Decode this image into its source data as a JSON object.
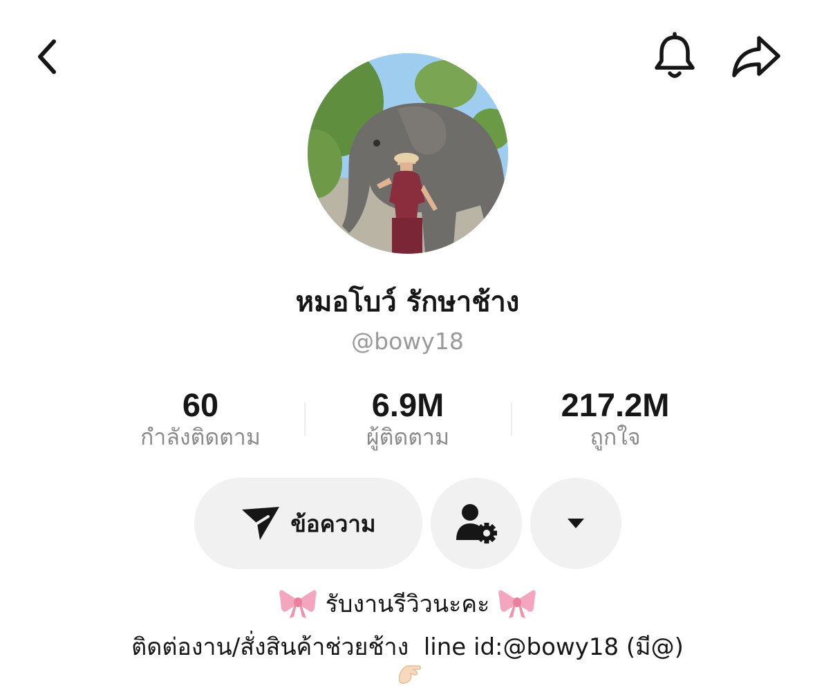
{
  "nav": {
    "back_icon": "chevron-left-icon",
    "bell_icon": "bell-icon",
    "share_icon": "share-icon"
  },
  "profile": {
    "display_name": "หมอโบว์ รักษาช้าง",
    "username": "@bowy18"
  },
  "stats": {
    "following": {
      "value": "60",
      "label": "กำลังติดตาม"
    },
    "followers": {
      "value": "6.9M",
      "label": "ผู้ติดตาม"
    },
    "likes": {
      "value": "217.2M",
      "label": "ถูกใจ"
    }
  },
  "actions": {
    "message_label": "ข้อความ",
    "message_icon": "send-icon",
    "person_settings_icon": "person-settings-icon",
    "more_icon": "caret-down-icon"
  },
  "bio": {
    "line1": "รับงานรีวิวนะคะ",
    "line2": "ติดต่องาน/สั่งสินค้าช่วยช้าง  line id:@bowy18 (มี@)",
    "emoji_icons": [
      "ribbon-icon",
      "ribbon-icon",
      "hand-icon"
    ]
  },
  "colors": {
    "text": "#161616",
    "muted": "#9a9a9a",
    "button_bg": "#f1f1f1",
    "ribbon": "#f3a6bd"
  }
}
